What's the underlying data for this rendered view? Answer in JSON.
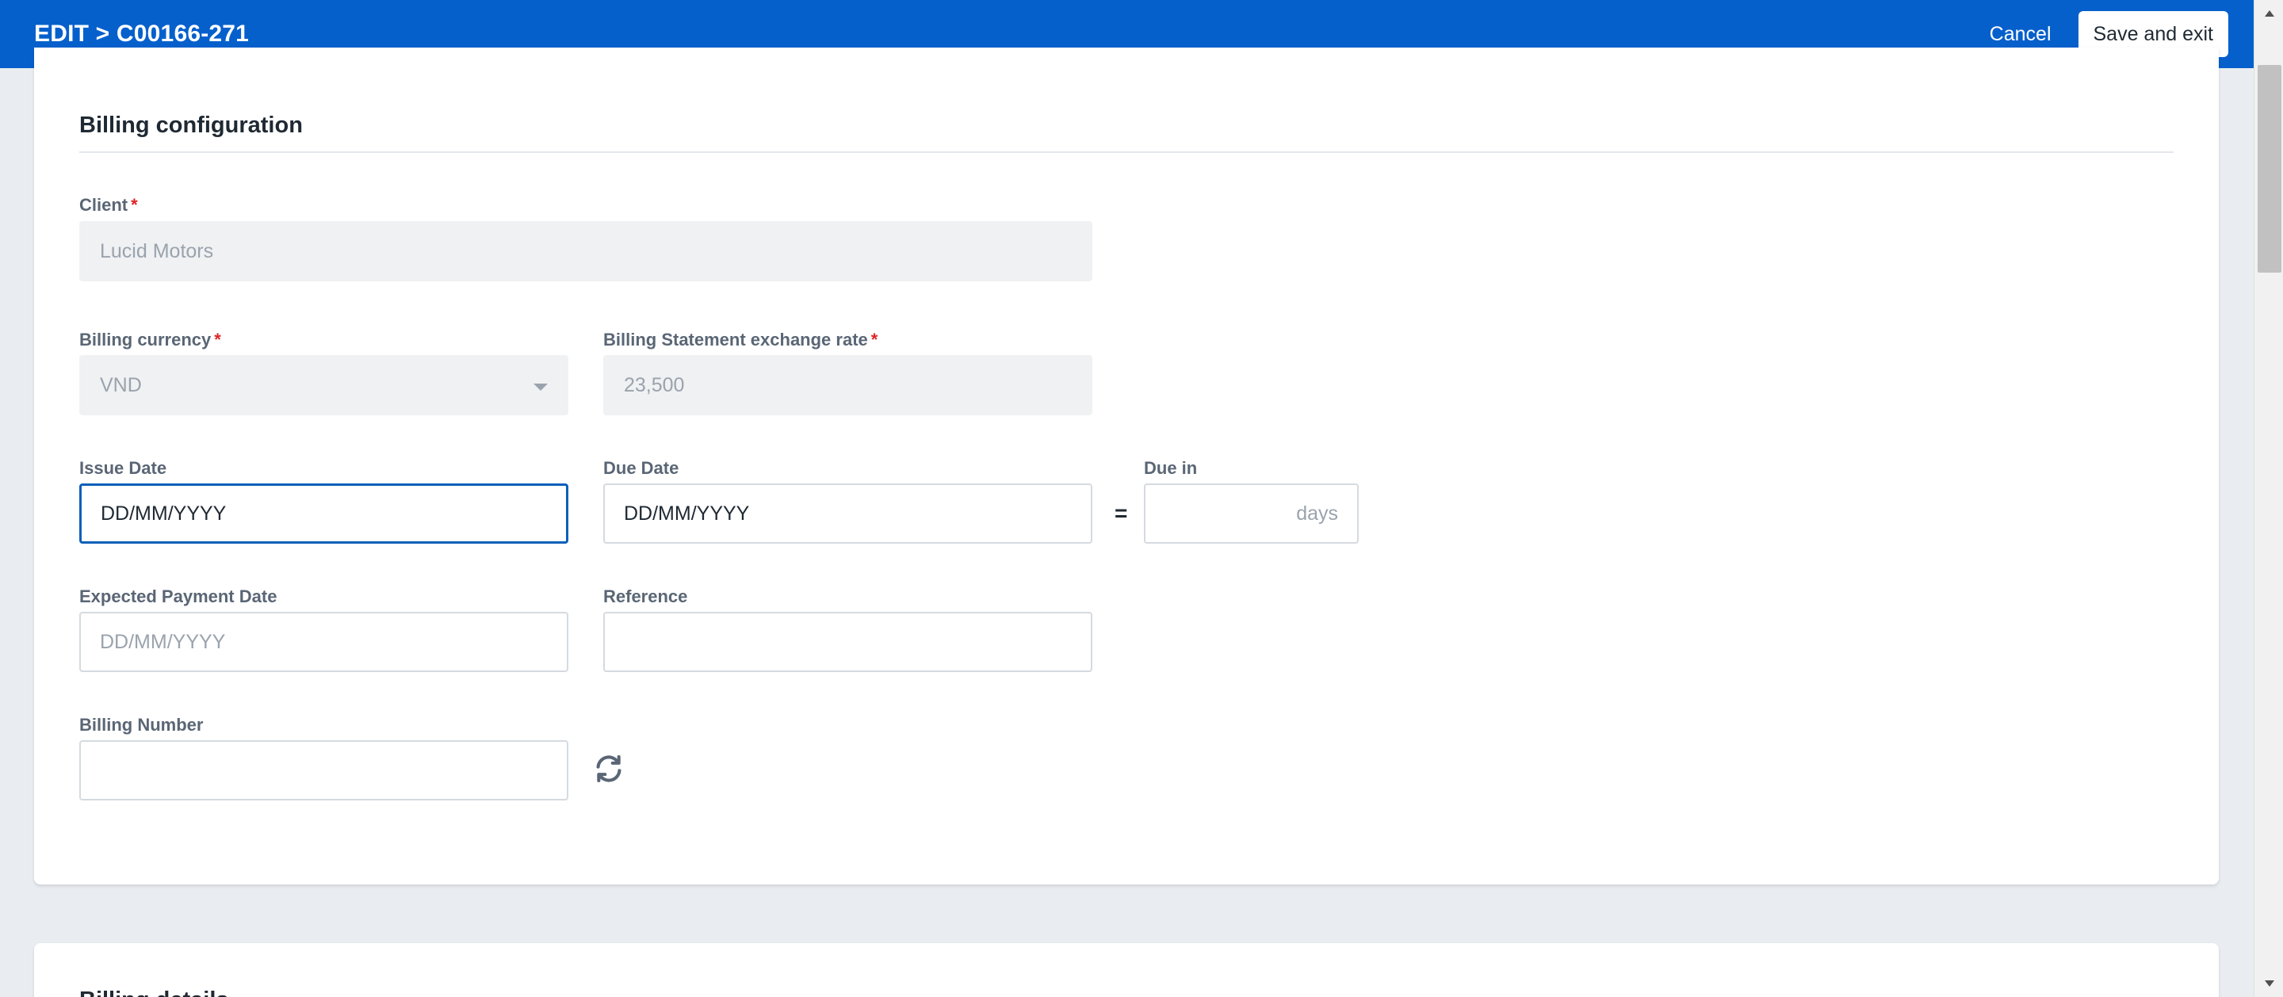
{
  "header": {
    "breadcrumb": "EDIT > C00166-271",
    "cancel_label": "Cancel",
    "save_label": "Save and exit"
  },
  "billing_config": {
    "title": "Billing configuration",
    "client": {
      "label": "Client",
      "required_mark": "*",
      "value": "Lucid Motors"
    },
    "billing_currency": {
      "label": "Billing currency",
      "required_mark": "*",
      "value": "VND"
    },
    "exchange_rate": {
      "label": "Billing Statement exchange rate",
      "required_mark": "*",
      "value": "23,500"
    },
    "issue_date": {
      "label": "Issue Date",
      "value": "DD/MM/YYYY"
    },
    "due_date": {
      "label": "Due Date",
      "value": "DD/MM/YYYY"
    },
    "equals": "=",
    "due_in": {
      "label": "Due in",
      "suffix": "days",
      "value": ""
    },
    "expected_payment_date": {
      "label": "Expected Payment Date",
      "placeholder": "DD/MM/YYYY"
    },
    "reference": {
      "label": "Reference",
      "value": ""
    },
    "billing_number": {
      "label": "Billing Number",
      "value": ""
    }
  },
  "billing_details": {
    "title": "Billing details"
  },
  "icons": {
    "dropdown": "chevron-down-icon",
    "refresh": "refresh-icon",
    "scroll_up": "scroll-up-arrow-icon",
    "scroll_down": "scroll-down-arrow-icon"
  },
  "colors": {
    "header_bg": "#0660cc",
    "page_bg": "#e9edf1",
    "required": "#e02424",
    "focus_border": "#0b5fba"
  }
}
